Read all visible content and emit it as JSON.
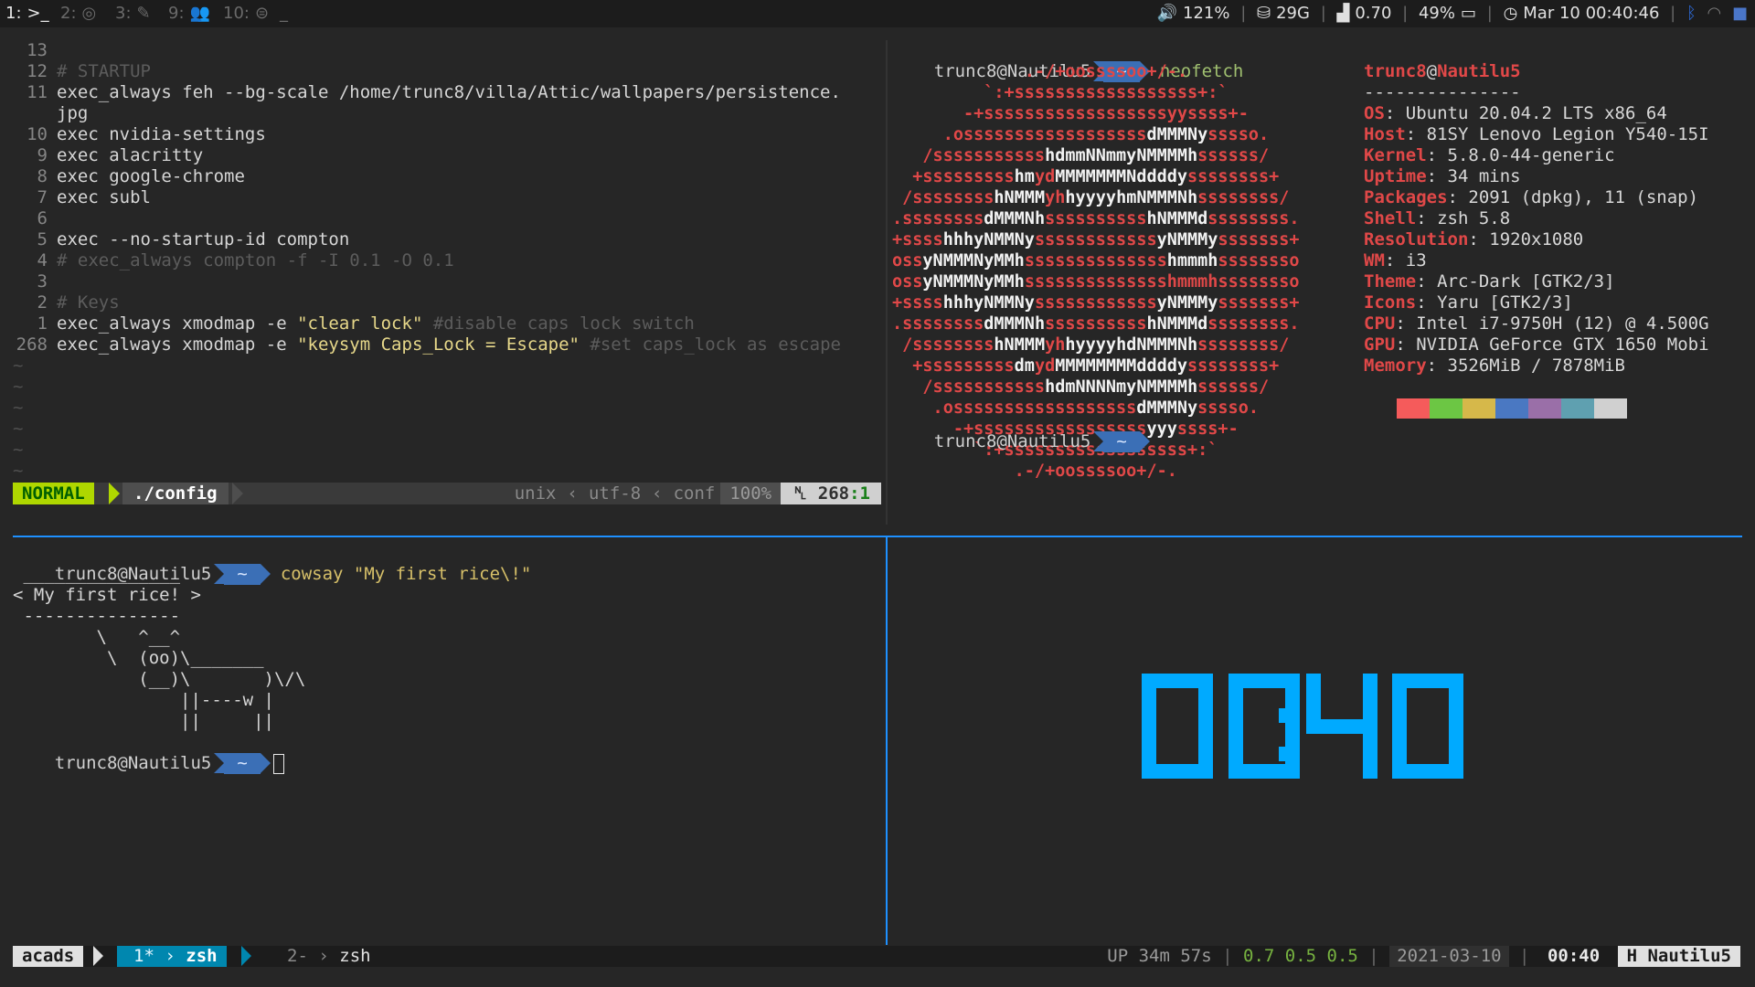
{
  "topbar": {
    "workspaces": [
      {
        "num": "1:",
        "icon": ">_",
        "icon_name": "terminal-icon",
        "active": true
      },
      {
        "num": "2:",
        "icon": "◎",
        "icon_name": "chrome-icon",
        "active": false
      },
      {
        "num": "3:",
        "icon": "✎",
        "icon_name": "editor-icon",
        "active": false
      },
      {
        "num": "9:",
        "icon": "👥",
        "icon_name": "group-icon",
        "active": false
      },
      {
        "num": "10:",
        "icon": "⊜",
        "icon_name": "misc-icon",
        "active": false
      }
    ],
    "cursor": "_",
    "volume": "121%",
    "disk": "29G",
    "load": "0.70",
    "battery": "49%",
    "datetime": "Mar 10 00:40:46"
  },
  "vim": {
    "lines": [
      {
        "n": "13",
        "parts": [
          {
            "t": "",
            "c": "code"
          }
        ]
      },
      {
        "n": "12",
        "parts": [
          {
            "t": "# STARTUP",
            "c": "cmt"
          }
        ]
      },
      {
        "n": "11",
        "parts": [
          {
            "t": "exec_always feh --bg-scale /home/trunc8/villa/Attic/wallpapers/persistence.",
            "c": "code"
          }
        ]
      },
      {
        "n": "",
        "parts": [
          {
            "t": "jpg",
            "c": "code"
          }
        ]
      },
      {
        "n": "10",
        "parts": [
          {
            "t": "exec nvidia-settings",
            "c": "code"
          }
        ]
      },
      {
        "n": "9",
        "parts": [
          {
            "t": "exec alacritty",
            "c": "code"
          }
        ]
      },
      {
        "n": "8",
        "parts": [
          {
            "t": "exec google-chrome",
            "c": "code"
          }
        ]
      },
      {
        "n": "7",
        "parts": [
          {
            "t": "exec subl",
            "c": "code"
          }
        ]
      },
      {
        "n": "6",
        "parts": [
          {
            "t": "",
            "c": "code"
          }
        ]
      },
      {
        "n": "5",
        "parts": [
          {
            "t": "exec --no-startup-id compton",
            "c": "code"
          }
        ]
      },
      {
        "n": "4",
        "parts": [
          {
            "t": "# exec_always compton -f -I 0.1 -O 0.1",
            "c": "cmt"
          }
        ]
      },
      {
        "n": "3",
        "parts": [
          {
            "t": "",
            "c": "code"
          }
        ]
      },
      {
        "n": "2",
        "parts": [
          {
            "t": "# Keys",
            "c": "cmt"
          }
        ]
      },
      {
        "n": "1",
        "parts": [
          {
            "t": "exec_always xmodmap -e ",
            "c": "code"
          },
          {
            "t": "\"clear lock\"",
            "c": "str"
          },
          {
            "t": " #disable caps lock switch",
            "c": "cmt"
          }
        ]
      },
      {
        "n": "268",
        "parts": [
          {
            "t": "exec_always xmodmap -e ",
            "c": "code"
          },
          {
            "t": "\"keysym Caps_Lock = Escape\"",
            "c": "str"
          },
          {
            "t": " #set caps_lock as escape",
            "c": "cmt"
          }
        ]
      }
    ],
    "tildes": [
      "~",
      "~",
      "~",
      "~",
      "~",
      "~"
    ],
    "status": {
      "mode": "NORMAL",
      "file": "./config",
      "fileformat": "unix",
      "encoding": "utf-8",
      "filetype": "conf",
      "percent": "100%",
      "line_icon": "␤",
      "line": "268",
      "col": ":1"
    }
  },
  "neofetch": {
    "prompt_host": "trunc8@Nautilu5",
    "prompt_dir": "~",
    "command": "neofetch",
    "art": [
      [
        [
          "r",
          "             .-/+oossssoo+/-.               "
        ]
      ],
      [
        [
          "r",
          "         `:+ssssssssssssssssss+:`           "
        ]
      ],
      [
        [
          "r",
          "       -+ssssssssssssssssssyyssss+-         "
        ]
      ],
      [
        [
          "r",
          "     .ossssssssssssssssss"
        ],
        [
          "w",
          "dMMMNy"
        ],
        [
          "r",
          "sssso.       "
        ]
      ],
      [
        [
          "r",
          "   /sssssssssss"
        ],
        [
          "w",
          "hdmmNNmmyNMMMMh"
        ],
        [
          "r",
          "ssssss/      "
        ]
      ],
      [
        [
          "r",
          "  +sssssssss"
        ],
        [
          "w",
          "hm"
        ],
        [
          "r",
          "yd"
        ],
        [
          "w",
          "MMMMMMMNddddy"
        ],
        [
          "r",
          "ssssssss+     "
        ]
      ],
      [
        [
          "r",
          " /ssssssss"
        ],
        [
          "w",
          "hNMMM"
        ],
        [
          "r",
          "yh"
        ],
        [
          "w",
          "hyyyyhmNMMMNh"
        ],
        [
          "r",
          "ssssssss/    "
        ]
      ],
      [
        [
          "r",
          ".ssssssss"
        ],
        [
          "w",
          "dMMMNh"
        ],
        [
          "r",
          "ssssssssss"
        ],
        [
          "w",
          "hNMMMd"
        ],
        [
          "r",
          "ssssssss.   "
        ]
      ],
      [
        [
          "r",
          "+ssss"
        ],
        [
          "w",
          "hhhyNMMNy"
        ],
        [
          "r",
          "ssssssssssss"
        ],
        [
          "w",
          "yNMMMy"
        ],
        [
          "r",
          "sssssss+   "
        ]
      ],
      [
        [
          "r",
          "oss"
        ],
        [
          "w",
          "yNMMMNyMMh"
        ],
        [
          "r",
          "ssssssssssssss"
        ],
        [
          "w",
          "hmmmh"
        ],
        [
          "r",
          "ssssssso   "
        ]
      ],
      [
        [
          "r",
          "oss"
        ],
        [
          "w",
          "yNMMMNyMMh"
        ],
        [
          "r",
          "sssssssssssssshmmmh"
        ],
        [
          "r",
          "ssssssso   "
        ]
      ],
      [
        [
          "r",
          "+ssss"
        ],
        [
          "w",
          "hhhyNMMNy"
        ],
        [
          "r",
          "ssssssssssss"
        ],
        [
          "w",
          "yNMMMy"
        ],
        [
          "r",
          "sssssss+   "
        ]
      ],
      [
        [
          "r",
          ".ssssssss"
        ],
        [
          "w",
          "dMMMNh"
        ],
        [
          "r",
          "ssssssssss"
        ],
        [
          "w",
          "hNMMMd"
        ],
        [
          "r",
          "ssssssss.   "
        ]
      ],
      [
        [
          "r",
          " /ssssssss"
        ],
        [
          "w",
          "hNMMM"
        ],
        [
          "r",
          "yh"
        ],
        [
          "w",
          "hyyyyhdNMMMNh"
        ],
        [
          "r",
          "ssssssss/    "
        ]
      ],
      [
        [
          "r",
          "  +sssssssss"
        ],
        [
          "w",
          "dm"
        ],
        [
          "r",
          "yd"
        ],
        [
          "w",
          "MMMMMMMMddddy"
        ],
        [
          "r",
          "ssssssss+     "
        ]
      ],
      [
        [
          "r",
          "   /sssssssssss"
        ],
        [
          "w",
          "hdmNNNNmyNMMMMh"
        ],
        [
          "r",
          "ssssss/      "
        ]
      ],
      [
        [
          "r",
          "    .ossssssssssssssssss"
        ],
        [
          "w",
          "dMMMNy"
        ],
        [
          "r",
          "sssso.       "
        ]
      ],
      [
        [
          "r",
          "      -+sssssssssssssssss"
        ],
        [
          "w",
          "yyy"
        ],
        [
          "r",
          "ssss+-         "
        ]
      ],
      [
        [
          "r",
          "        `:+ssssssssssssssssss+:`           "
        ]
      ],
      [
        [
          "r",
          "            .-/+oossssoo+/-.               "
        ]
      ]
    ],
    "user": "trunc8",
    "host": "Nautilu5",
    "divider": "---------------",
    "info": [
      {
        "k": "OS",
        "v": "Ubuntu 20.04.2 LTS x86_64"
      },
      {
        "k": "Host",
        "v": "81SY Lenovo Legion Y540-15I"
      },
      {
        "k": "Kernel",
        "v": "5.8.0-44-generic"
      },
      {
        "k": "Uptime",
        "v": "34 mins"
      },
      {
        "k": "Packages",
        "v": "2091 (dpkg), 11 (snap)"
      },
      {
        "k": "Shell",
        "v": "zsh 5.8"
      },
      {
        "k": "Resolution",
        "v": "1920x1080"
      },
      {
        "k": "WM",
        "v": "i3"
      },
      {
        "k": "Theme",
        "v": "Arc-Dark [GTK2/3]"
      },
      {
        "k": "Icons",
        "v": "Yaru [GTK2/3]"
      },
      {
        "k": "CPU",
        "v": "Intel i7-9750H (12) @ 4.500G"
      },
      {
        "k": "GPU",
        "v": "NVIDIA GeForce GTX 1650 Mobi"
      },
      {
        "k": "Memory",
        "v": "3526MiB / 7878MiB"
      }
    ],
    "palette": [
      "#262626",
      "#f55b5b",
      "#6cc644",
      "#d6b84a",
      "#4a78c2",
      "#9a6fa8",
      "#5fa0b0",
      "#d0d0d0"
    ],
    "prompt2_host": "trunc8@Nautilu5",
    "prompt2_dir": "~"
  },
  "cowsay": {
    "prompt_host": "trunc8@Nautilu5",
    "prompt_dir": "~",
    "command": "cowsay \"My first rice\\!\"",
    "output": [
      " _______________",
      "< My first rice! >",
      " ---------------",
      "        \\   ^__^",
      "         \\  (oo)\\_______",
      "            (__)\\       )\\/\\",
      "                ||----w |",
      "                ||     ||"
    ],
    "prompt2_host": "trunc8@Nautilu5",
    "prompt2_dir": "~"
  },
  "clock": {
    "text": "00:40",
    "color": "#00aaff"
  },
  "tmux": {
    "session": "acads",
    "active_window_num": "1*",
    "active_window_name": "zsh",
    "inactive_window_num": "2-",
    "inactive_window_name": "zsh",
    "uptime": "UP  34m 57s",
    "load": "0.7 0.5 0.5",
    "date": "2021-03-10",
    "time": "00:40",
    "host": "H Nautilu5"
  }
}
